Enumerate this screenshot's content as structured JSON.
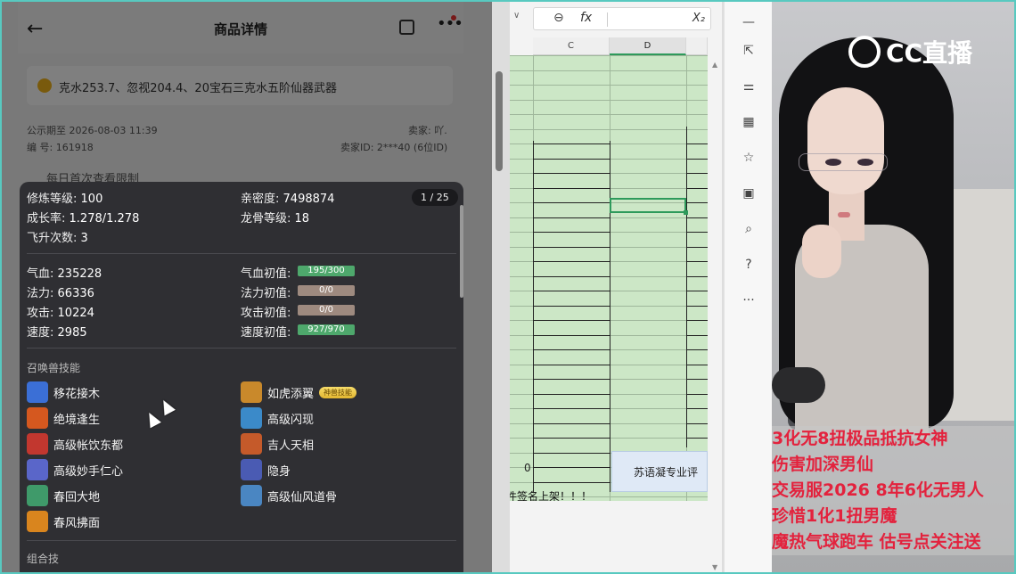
{
  "product": {
    "header_title": "商品详情",
    "card_text": "克水253.7、忽视204.4、20宝石三克水五阶仙器武器",
    "publicity": "公示期至 2026-08-03 11:39",
    "seller": "卖家: 吖.",
    "serial": "编 号: 161918",
    "seller_id": "卖家ID: 2***40 (6位ID)",
    "third_row_partial": "每日首次查看限制"
  },
  "pet_sheet": {
    "page_counter": "1 / 25",
    "stats": [
      {
        "k": "修炼等级:",
        "v": "100"
      },
      {
        "k": "亲密度:",
        "v": "7498874"
      },
      {
        "k": "成长率:",
        "v": "1.278/1.278"
      },
      {
        "k": "龙骨等级:",
        "v": "18"
      },
      {
        "k": "飞升次数:",
        "v": "3"
      }
    ],
    "attrs": [
      {
        "k": "气血:",
        "v": "235228",
        "ik": "气血初值:",
        "iv": "195/300",
        "fill": 0.65
      },
      {
        "k": "法力:",
        "v": "66336",
        "ik": "法力初值:",
        "iv": "0/0",
        "fill": 0
      },
      {
        "k": "攻击:",
        "v": "10224",
        "ik": "攻击初值:",
        "iv": "0/0",
        "fill": 0
      },
      {
        "k": "速度:",
        "v": "2985",
        "ik": "速度初值:",
        "iv": "927/970",
        "fill": 0.96
      }
    ],
    "skills_title": "召唤兽技能",
    "skills": [
      {
        "name": "移花接木",
        "color": "#3b6fd6"
      },
      {
        "name": "如虎添翼",
        "color": "#c9892b",
        "tag": "神兽技能"
      },
      {
        "name": "绝境逢生",
        "color": "#d5581f"
      },
      {
        "name": "高级闪现",
        "color": "#3b8ac9"
      },
      {
        "name": "高级帐饮东都",
        "color": "#c2372f"
      },
      {
        "name": "吉人天相",
        "color": "#c55a2a"
      },
      {
        "name": "高级妙手仁心",
        "color": "#5a66c9"
      },
      {
        "name": "隐身",
        "color": "#4a5bb3"
      },
      {
        "name": "春回大地",
        "color": "#3f9a6a"
      },
      {
        "name": "高级仙风道骨",
        "color": "#4a86c2"
      },
      {
        "name": "春风拂面",
        "color": "#d9851e"
      }
    ],
    "combo_title": "组合技"
  },
  "spreadsheet": {
    "col_c": "C",
    "col_d": "D",
    "zero": "0",
    "blue_cell": "苏语凝专业评",
    "bottom_text": "件签名上架！！！"
  },
  "stream": {
    "logo": "CC直播",
    "danmu": [
      "3化无8扭极品抵抗女神",
      "伤害加深男仙",
      "交易服2026 8年6化无男人",
      "珍惜1化1扭男魔",
      "魔热气球跑车   估号点关注送"
    ]
  }
}
